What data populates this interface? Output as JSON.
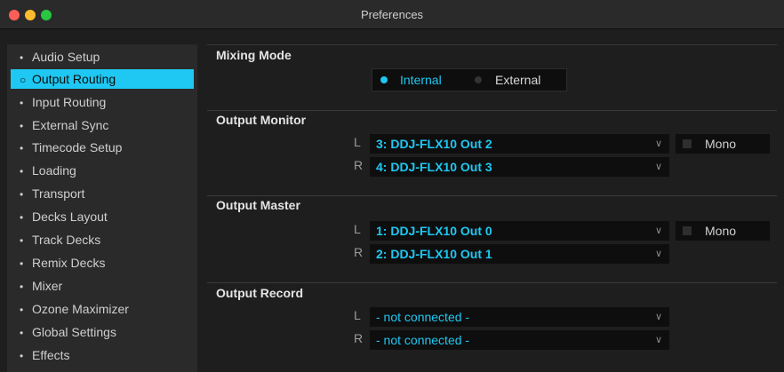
{
  "window": {
    "title": "Preferences"
  },
  "sidebar": {
    "items": [
      {
        "label": "Audio Setup",
        "active": false
      },
      {
        "label": "Output Routing",
        "active": true
      },
      {
        "label": "Input Routing",
        "active": false
      },
      {
        "label": "External Sync",
        "active": false
      },
      {
        "label": "Timecode Setup",
        "active": false
      },
      {
        "label": "Loading",
        "active": false
      },
      {
        "label": "Transport",
        "active": false
      },
      {
        "label": "Decks Layout",
        "active": false
      },
      {
        "label": "Track Decks",
        "active": false
      },
      {
        "label": "Remix Decks",
        "active": false
      },
      {
        "label": "Mixer",
        "active": false
      },
      {
        "label": "Ozone Maximizer",
        "active": false
      },
      {
        "label": "Global Settings",
        "active": false
      },
      {
        "label": "Effects",
        "active": false
      }
    ]
  },
  "mixing_mode": {
    "title": "Mixing Mode",
    "internal_label": "Internal",
    "external_label": "External",
    "selected": "Internal"
  },
  "output_monitor": {
    "title": "Output Monitor",
    "left_label": "L",
    "left_value": "3: DDJ-FLX10 Out 2",
    "right_label": "R",
    "right_value": "4: DDJ-FLX10 Out 3",
    "mono_label": "Mono"
  },
  "output_master": {
    "title": "Output Master",
    "left_label": "L",
    "left_value": "1: DDJ-FLX10 Out 0",
    "right_label": "R",
    "right_value": "2: DDJ-FLX10 Out 1",
    "mono_label": "Mono"
  },
  "output_record": {
    "title": "Output Record",
    "left_label": "L",
    "left_value": "- not connected -",
    "right_label": "R",
    "right_value": "- not connected -"
  },
  "colors": {
    "accent": "#1ec8f2",
    "background": "#1e1e1e",
    "panel": "#2a2a2a"
  }
}
